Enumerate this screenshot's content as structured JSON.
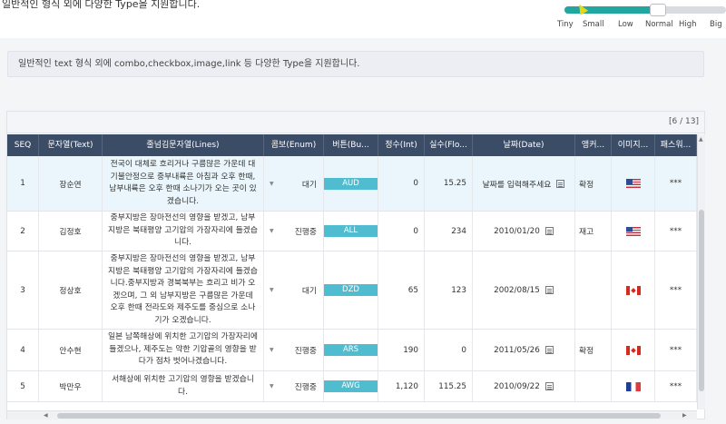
{
  "header": {
    "cut_title": "일반적인 형식 외에 다양한 Type을 지원합니다."
  },
  "size_slider": {
    "value": 0.58,
    "labels": [
      "Tiny",
      "Small",
      "Low",
      "Normal",
      "High",
      "Big"
    ],
    "selected": "Normal"
  },
  "notice": {
    "text": "일반적인 text 형식 외에 combo,checkbox,image,link 등 다양한 Type을 지원합니다."
  },
  "grid": {
    "count": "[6 / 13]",
    "columns": [
      "SEQ",
      "문자열(Text)",
      "줄넘김문자열(Lines)",
      "콤보(Enum)",
      "버튼(Bu...",
      "정수(Int)",
      "실수(Flo...",
      "날짜(Date)",
      "앵커...",
      "이미지...",
      "패스워..."
    ],
    "rows": [
      {
        "seq": "1",
        "text": "장순연",
        "lines": "전국이 대체로 흐리거나 구름많은 가운데 대기불안정으로 중부내륙은 아침과 오후 한때, 남부내륙은 오후 한때 소나기가 오는 곳이 있겠습니다.",
        "enum": "대기",
        "button": "AUD",
        "int": "0",
        "float": "15.25",
        "date": "날짜를 입력해주세요",
        "anchor": "확정",
        "flag": "us",
        "password": "***"
      },
      {
        "seq": "2",
        "text": "김정호",
        "lines": "중부지방은 장마전선의 영향을 받겠고, 남부지방은 북태평양 고기압의 가장자리에 들겠습니다.",
        "enum": "진행중",
        "button": "ALL",
        "int": "0",
        "float": "234",
        "date": "2010/01/20",
        "anchor": "재고",
        "flag": "us",
        "password": "***"
      },
      {
        "seq": "3",
        "text": "정상호",
        "lines": "중부지방은 장마전선의 영향을 받겠고, 남부지방은 북태평양 고기압의 가장자리에 들겠습니다.중부지방과 경북북부는 흐리고 비가 오겠으며, 그 외 남부지방은 구름많은 가운데 오후 한때 전라도와 제주도를 중심으로 소나기가 오겠습니다.",
        "enum": "대기",
        "button": "DZD",
        "int": "65",
        "float": "123",
        "date": "2002/08/15",
        "anchor": "",
        "flag": "ca",
        "password": "***"
      },
      {
        "seq": "4",
        "text": "안수현",
        "lines": "일본 남쪽해상에 위치한 고기압의 가장자리에 들겠으나, 제주도는 약한 기압골의 영향을 받다가 점차 벗어나겠습니다.",
        "enum": "진행중",
        "button": "ARS",
        "int": "190",
        "float": "0",
        "date": "2011/05/26",
        "anchor": "확정",
        "flag": "ca",
        "password": "***"
      },
      {
        "seq": "5",
        "text": "박만우",
        "lines": "서해상에 위치한 고기압의 영향을 받겠습니다.",
        "enum": "진행중",
        "button": "AWG",
        "int": "1,120",
        "float": "115.25",
        "date": "2010/09/22",
        "anchor": "",
        "flag": "fr",
        "password": "***"
      }
    ]
  }
}
